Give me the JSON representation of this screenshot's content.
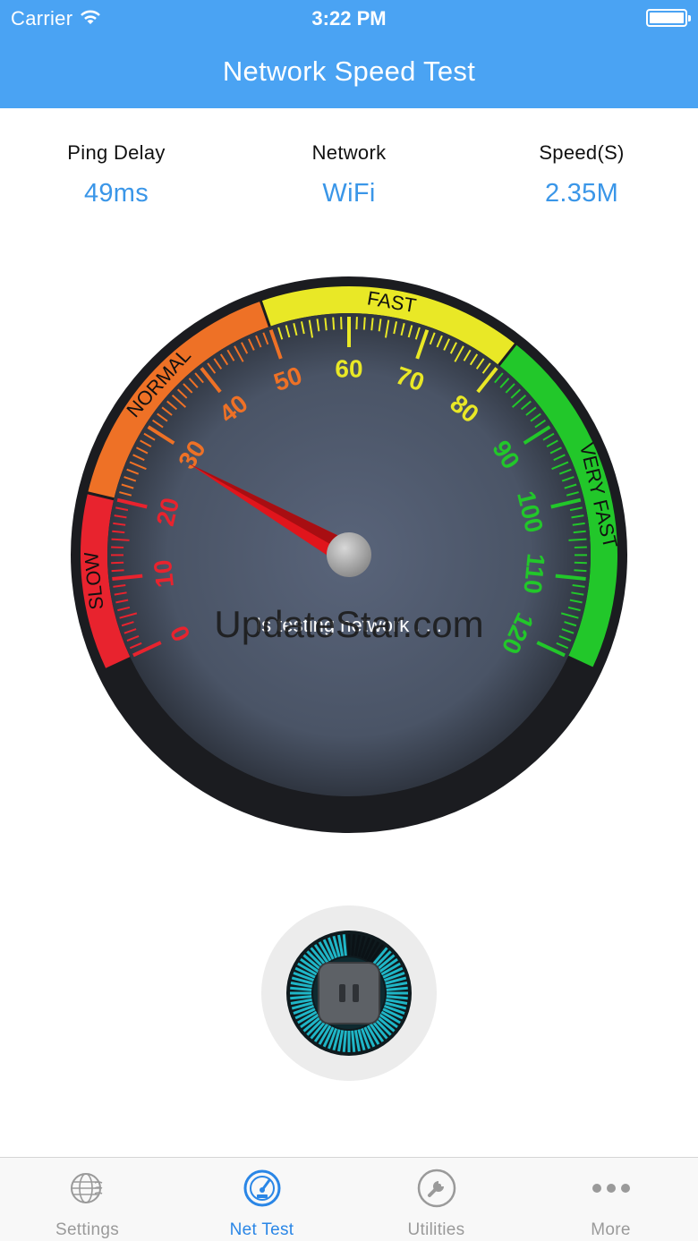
{
  "status_bar": {
    "carrier": "Carrier",
    "time": "3:22 PM",
    "wifi_icon": "wifi-icon",
    "battery_icon": "battery-icon"
  },
  "nav": {
    "title": "Network Speed Test"
  },
  "stats": [
    {
      "label": "Ping Delay",
      "value": "49ms"
    },
    {
      "label": "Network",
      "value": "WiFi"
    },
    {
      "label": "Speed(S)",
      "value": "2.35M"
    }
  ],
  "gauge": {
    "min": 0,
    "max": 120,
    "needle_value": 28.5,
    "tick_labels": [
      "0",
      "10",
      "20",
      "30",
      "40",
      "50",
      "60",
      "70",
      "80",
      "90",
      "100",
      "110",
      "120"
    ],
    "zones": [
      {
        "label": "SLOW",
        "from": 0,
        "to": 20,
        "color": "#e8232e"
      },
      {
        "label": "NORMAL",
        "from": 20,
        "to": 50,
        "color": "#ee7126"
      },
      {
        "label": "FAST",
        "from": 50,
        "to": 80,
        "color": "#e9e826"
      },
      {
        "label": "VERY FAST",
        "from": 80,
        "to": 120,
        "color": "#22c72a"
      }
    ],
    "status_text": "Is testing network . . .",
    "watermark": "UpdateStar.com",
    "face_color": "#4d5769"
  },
  "control": {
    "button_icon": "pause-icon",
    "progress": 0.1
  },
  "tabs": [
    {
      "label": "Settings",
      "icon": "settings-globe-icon",
      "active": false
    },
    {
      "label": "Net Test",
      "icon": "speedometer-icon",
      "active": true
    },
    {
      "label": "Utilities",
      "icon": "wrench-icon",
      "active": false
    },
    {
      "label": "More",
      "icon": "more-dots-icon",
      "active": false
    }
  ],
  "colors": {
    "accent": "#4aa3f3",
    "stat_value": "#3a96e8",
    "tab_active": "#2a86e6",
    "tab_inactive": "#9a9a9a"
  }
}
